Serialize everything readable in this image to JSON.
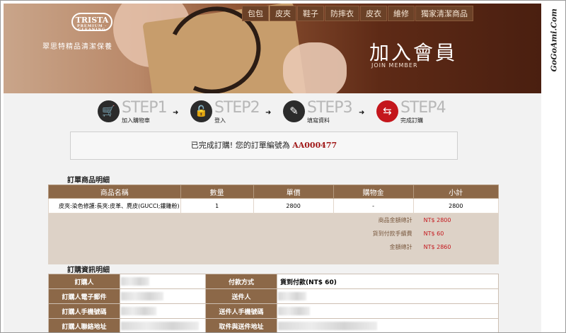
{
  "brand": {
    "logo_text": "TRISTA",
    "logo_sub": "PREMIUM · CLEANING",
    "tagline": "翠思特精品清潔保養"
  },
  "nav": {
    "items": [
      "包包",
      "皮夾",
      "鞋子",
      "防摔衣",
      "皮衣",
      "維修",
      "獨家清潔商品"
    ]
  },
  "hero": {
    "title": "加入會員",
    "subtitle": "JOIN MEMBER"
  },
  "steps": [
    {
      "label": "STEP1",
      "caption": "加入購物車",
      "icon": "cart-icon"
    },
    {
      "label": "STEP2",
      "caption": "登入",
      "icon": "lock-icon"
    },
    {
      "label": "STEP3",
      "caption": "填寫資料",
      "icon": "edit-icon"
    },
    {
      "label": "STEP4",
      "caption": "完成訂購",
      "icon": "refresh-icon"
    }
  ],
  "confirm": {
    "text": "已完成訂購! 您的訂單編號為",
    "order_no": "AA000477"
  },
  "order_section": {
    "title": "訂單商品明細",
    "headers": [
      "商品名稱",
      "數量",
      "單價",
      "購物金",
      "小計"
    ],
    "rows": [
      {
        "name": "皮夾:染色修護:長夾:皮革、麂皮(GUCCI;鏤雕粉)",
        "qty": "1",
        "price": "2800",
        "credit": "-",
        "subtotal": "2800"
      }
    ],
    "summary": [
      {
        "label": "商品金額總計",
        "value": "NT$ 2800"
      },
      {
        "label": "貨到付款手續費",
        "value": "NT$ 60"
      },
      {
        "label": "金額總計",
        "value": "NT$ 2860"
      }
    ]
  },
  "info_section": {
    "title": "訂購資訊明細",
    "left_labels": [
      "訂購人",
      "訂購人電子郵件",
      "訂購人手機號碼",
      "訂購人聯絡地址"
    ],
    "right_labels": [
      "付款方式",
      "送件人",
      "送件人手機號碼",
      "取件與送件地址"
    ],
    "payment_value": "貨到付款(NT$ 60)"
  },
  "watermark": "GoGoAmi.Com",
  "colors": {
    "accent": "#c4161c",
    "table_header": "#8c6848",
    "nav_bg": "#6b4127"
  }
}
